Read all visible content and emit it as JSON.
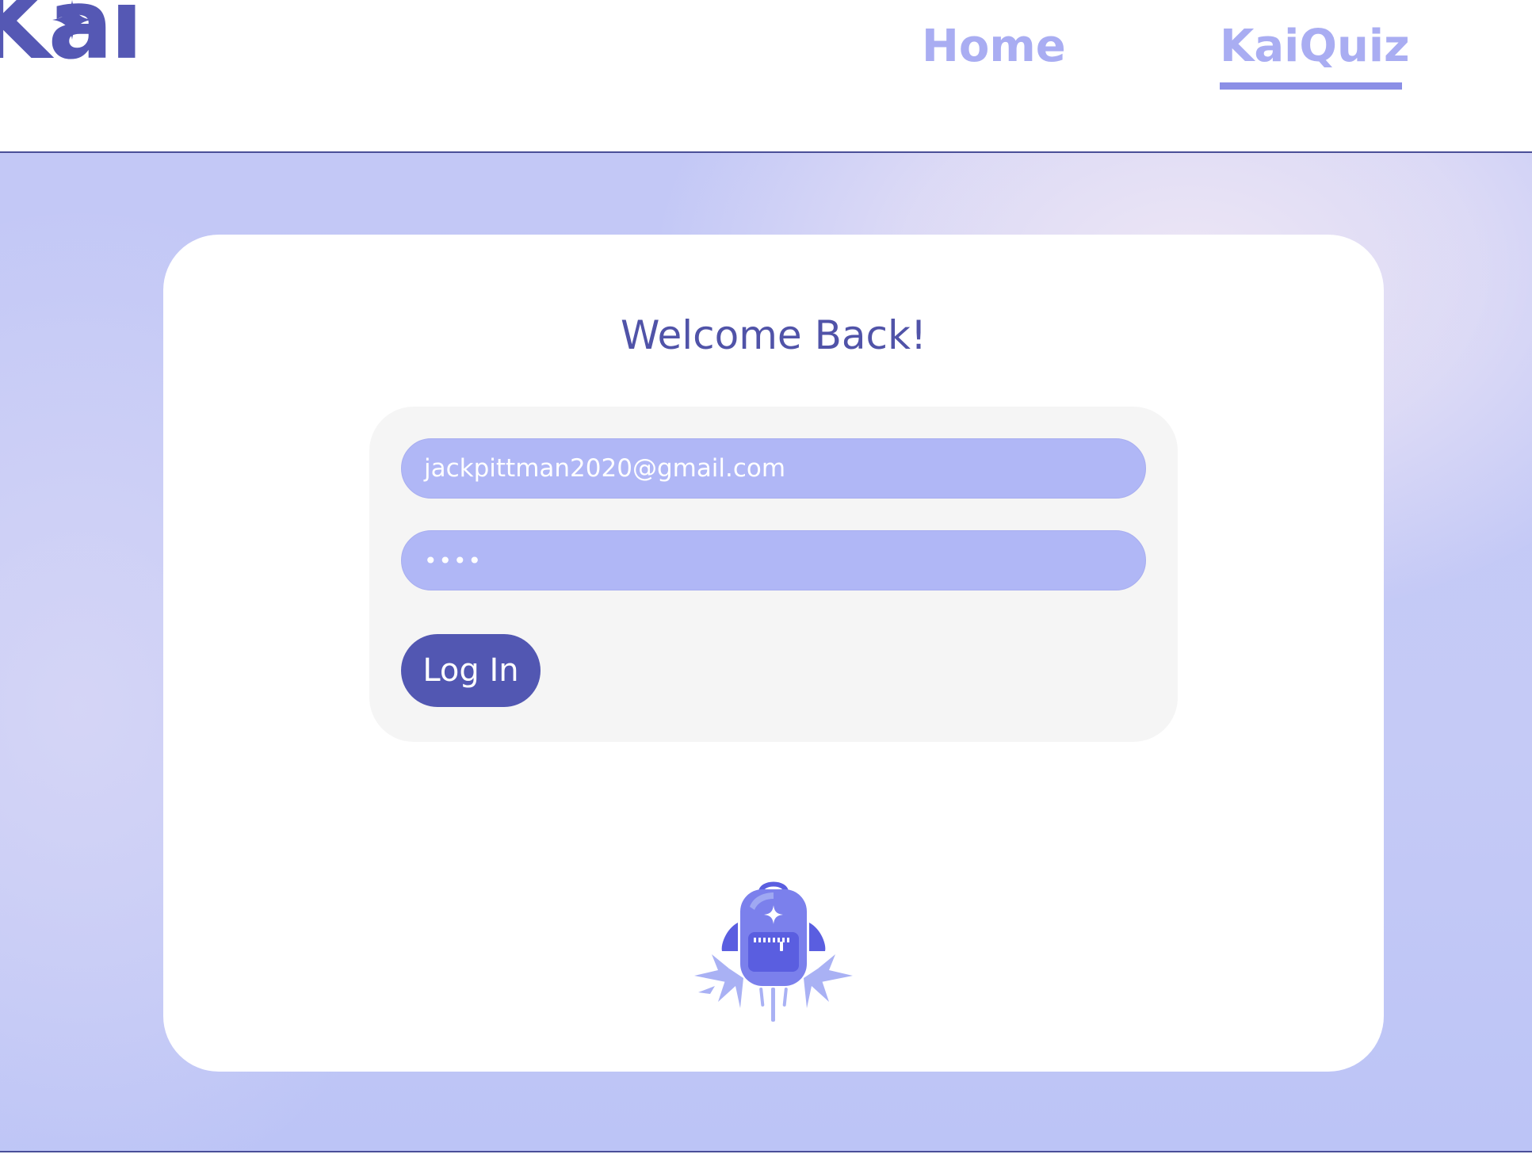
{
  "header": {
    "logo_text": "Kai",
    "logo_icon": "sparkle-star-icon",
    "nav": [
      {
        "label": "Home",
        "active": false
      },
      {
        "label": "KaiQuiz",
        "active": true
      }
    ]
  },
  "login": {
    "title": "Welcome Back!",
    "email_value": "jackpittman2020@gmail.com",
    "password_value": "••••",
    "submit_label": "Log In",
    "illustration_icon": "rocket-backpack-icon"
  },
  "colors": {
    "brand": "#5257b2",
    "nav_link": "#a9adf2",
    "field_bg": "#b0b7f6",
    "panel_bg": "#f5f5f5"
  }
}
